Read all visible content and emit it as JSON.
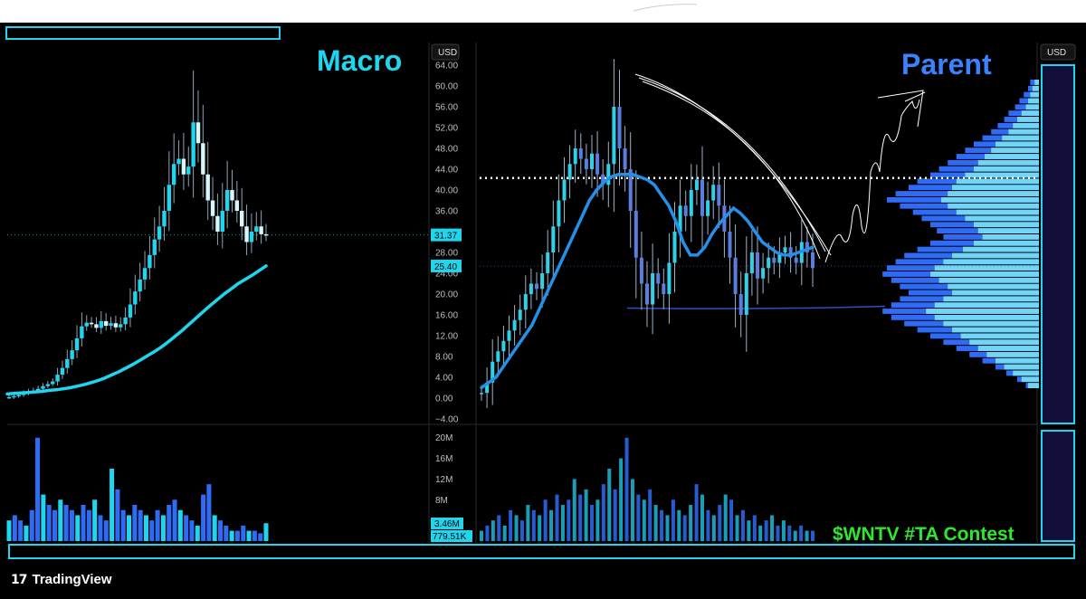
{
  "footer": {
    "logo_mark": "17",
    "brand": "TradingView"
  },
  "colors": {
    "cyan": "#1fd6ee",
    "blue": "#2f6bf5",
    "green": "#2ee82e",
    "parent_title": "#3b82ff"
  },
  "chart_data": [
    {
      "type": "line",
      "title": "Macro",
      "y_axis_ticks": [
        "64.00",
        "60.00",
        "56.00",
        "52.00",
        "48.00",
        "44.00",
        "40.00",
        "36.00",
        "32.00",
        "28.00",
        "24.00",
        "20.00",
        "16.00",
        "12.00",
        "8.00",
        "4.00",
        "0.00",
        "−4.00"
      ],
      "ylim": [
        -4,
        64
      ],
      "currency": "USD",
      "price_labels": [
        "31.37",
        "25.40"
      ],
      "last_price": 31.37,
      "moving_average_last": 25.4,
      "volume_ticks": [
        "20M",
        "16M",
        "12M",
        "8M"
      ],
      "volume_labels": [
        "3.46M",
        "779.51K"
      ],
      "price_series": [
        0.2,
        0.4,
        0.6,
        0.9,
        1.2,
        1.4,
        1.8,
        2.3,
        2.7,
        3.2,
        4.5,
        5.8,
        7.5,
        9.2,
        11.5,
        13.8,
        14.5,
        14.2,
        13.5,
        14.8,
        13.9,
        14.4,
        13.6,
        14.2,
        15.5,
        18,
        20.5,
        22.8,
        25,
        27.5,
        30.5,
        33,
        36,
        41,
        45,
        46,
        43,
        44.5,
        53,
        49,
        43,
        38,
        35,
        32,
        36,
        40,
        38,
        36,
        33,
        30,
        32,
        33,
        31.5,
        31.37
      ],
      "ma_series": [
        0.8,
        0.9,
        1.0,
        1.1,
        1.2,
        1.3,
        1.5,
        1.6,
        1.8,
        2.0,
        2.3,
        2.6,
        3.0,
        3.4,
        3.9,
        4.5,
        5.1,
        5.8,
        6.5,
        7.3,
        8.1,
        8.9,
        9.8,
        10.8,
        11.9,
        13.0,
        14.2,
        15.4,
        16.6,
        17.8,
        18.9,
        20.0,
        21.0,
        22.0,
        22.8,
        23.6,
        24.5,
        25.4
      ],
      "volume_series": [
        4,
        5,
        4,
        3,
        6,
        20,
        9,
        7,
        6,
        8,
        7,
        6,
        5,
        7,
        6,
        8,
        5,
        4,
        14,
        10,
        6,
        5,
        7,
        6,
        5,
        4,
        6,
        5,
        7,
        8,
        6,
        5,
        4,
        3,
        9,
        11,
        5,
        4,
        3,
        2,
        2,
        3,
        2,
        2,
        1.5,
        3.46
      ]
    },
    {
      "type": "line",
      "title": "Parent",
      "currency": "USD",
      "ylim": [
        -4,
        64
      ],
      "resistance_level": 42.3,
      "support_level": 17.3,
      "price_series": [
        1,
        3,
        7,
        9,
        11,
        13,
        15,
        17,
        20,
        22,
        21,
        24,
        28,
        33,
        38,
        42,
        45,
        48,
        46,
        44,
        47,
        43,
        41,
        45,
        56,
        48,
        44,
        36,
        27,
        22,
        18,
        24,
        22,
        20,
        26,
        32,
        37,
        35,
        40,
        42,
        35,
        38,
        41,
        37,
        32,
        27,
        20,
        16,
        24,
        28,
        23,
        25,
        27,
        26,
        28,
        29,
        27,
        26,
        30,
        28,
        25
      ],
      "ma_series": [
        2,
        3,
        4,
        6,
        8,
        10,
        12,
        14,
        17,
        20,
        23,
        26,
        29,
        32,
        35,
        38,
        40,
        41.5,
        42.5,
        43,
        43,
        43,
        42.5,
        42,
        41,
        39,
        37,
        34,
        30,
        27.5,
        27.5,
        29,
        31.5,
        33.5,
        35,
        36.5,
        35.5,
        34,
        32,
        30,
        29,
        28,
        27.5,
        27.5,
        28,
        28.5,
        29
      ],
      "volume_series": [
        2,
        3,
        4,
        5,
        3,
        6,
        5,
        4,
        7,
        6,
        5,
        8,
        6,
        9,
        7,
        8,
        12,
        9,
        10,
        7,
        8,
        11,
        14,
        10,
        16,
        20,
        12,
        9,
        8,
        10,
        7,
        6,
        5,
        8,
        6,
        5,
        7,
        11,
        9,
        6,
        5,
        7,
        9,
        8,
        5,
        6,
        4,
        5,
        3,
        4,
        5,
        3,
        4,
        3,
        2,
        3,
        2,
        2
      ],
      "volume_profile_cyan": [
        2,
        3,
        4,
        5,
        6,
        8,
        10,
        12,
        14,
        17,
        20,
        22,
        25,
        28,
        30,
        34,
        38,
        40,
        42,
        45,
        42,
        38,
        34,
        30,
        28,
        26,
        30,
        35,
        40,
        44,
        48,
        50,
        46,
        42,
        40,
        44,
        48,
        52,
        48,
        44,
        40,
        36,
        32,
        28,
        24,
        20,
        16,
        12,
        8,
        5
      ],
      "volume_profile_blue": [
        4,
        5,
        7,
        9,
        11,
        14,
        16,
        19,
        22,
        26,
        30,
        34,
        38,
        42,
        46,
        50,
        56,
        60,
        66,
        70,
        64,
        58,
        54,
        50,
        47,
        44,
        50,
        56,
        62,
        66,
        70,
        72,
        68,
        64,
        60,
        64,
        68,
        72,
        68,
        62,
        56,
        50,
        44,
        38,
        32,
        26,
        20,
        15,
        10,
        6
      ]
    }
  ],
  "annotation": {
    "text": "$WNTV #TA Contest"
  }
}
